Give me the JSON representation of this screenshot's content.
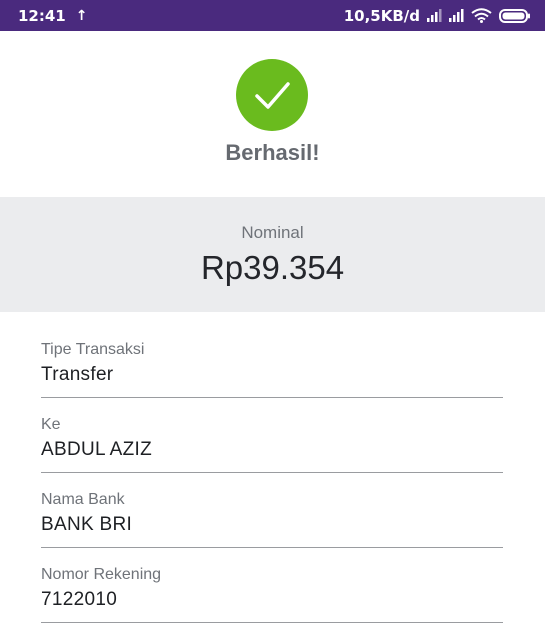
{
  "status_bar": {
    "time": "12:41",
    "upload_arrow": "↑",
    "network_speed": "10,5KB/d",
    "icons": [
      "signal-icon",
      "signal-icon",
      "wifi-icon",
      "battery-icon"
    ]
  },
  "success": {
    "icon": "check-icon",
    "title": "Berhasil!",
    "accent_color": "#6abb1e"
  },
  "nominal": {
    "label": "Nominal",
    "value": "Rp39.354"
  },
  "details": [
    {
      "label": "Tipe Transaksi",
      "value": "Transfer"
    },
    {
      "label": "Ke",
      "value": "ABDUL AZIZ"
    },
    {
      "label": "Nama Bank",
      "value": "BANK BRI"
    },
    {
      "label": "Nomor Rekening",
      "value": "7122010"
    }
  ],
  "colors": {
    "status_bar": "#4a2a7e",
    "panel_background": "#ebecee"
  }
}
